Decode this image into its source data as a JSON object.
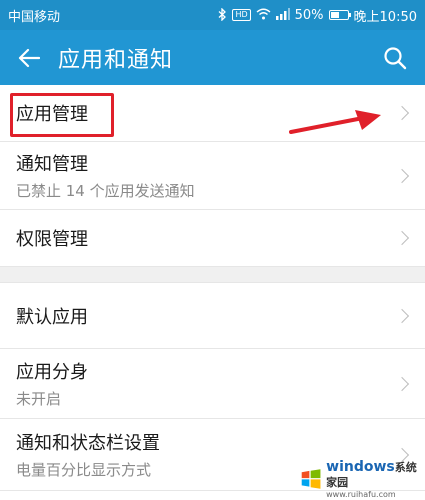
{
  "status_bar": {
    "carrier": "中国移动",
    "battery_percent": "50%",
    "battery_level": 0.5,
    "time": "晚上10:50",
    "hd_label": "HD",
    "icons": [
      "bluetooth-icon",
      "hd-icon",
      "wifi-icon",
      "signal-icon",
      "battery-icon"
    ]
  },
  "app_bar": {
    "title": "应用和通知",
    "icons": [
      "back-arrow-icon",
      "search-icon"
    ]
  },
  "menu": {
    "items": [
      {
        "title": "应用管理",
        "subtitle": ""
      },
      {
        "title": "通知管理",
        "subtitle": "已禁止 14 个应用发送通知"
      },
      {
        "title": "权限管理",
        "subtitle": ""
      },
      {
        "title": "默认应用",
        "subtitle": ""
      },
      {
        "title": "应用分身",
        "subtitle": "未开启"
      },
      {
        "title": "通知和状态栏设置",
        "subtitle": "电量百分比显示方式"
      }
    ]
  },
  "watermark": {
    "brand": "windows",
    "suffix": "系统家园",
    "url": "www.ruihafu.com"
  },
  "colors": {
    "status_bar": "#1f8fc8",
    "app_bar": "#2196d3",
    "highlight": "#e0202a"
  }
}
